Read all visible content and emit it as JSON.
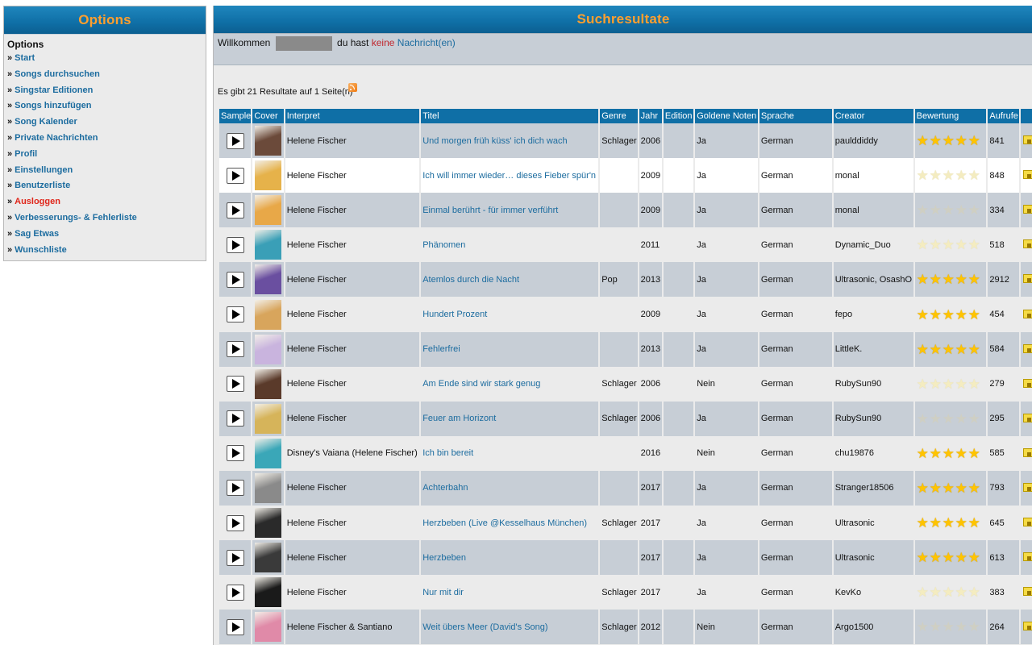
{
  "sidebar": {
    "header": "Options",
    "title": "Options",
    "items": [
      {
        "label": "Start"
      },
      {
        "label": "Songs durchsuchen"
      },
      {
        "label": "Singstar Editionen"
      },
      {
        "label": "Songs hinzufügen"
      },
      {
        "label": "Song Kalender"
      },
      {
        "label": "Private Nachrichten"
      },
      {
        "label": "Profil"
      },
      {
        "label": "Einstellungen"
      },
      {
        "label": "Benutzerliste"
      },
      {
        "label": "Ausloggen",
        "style": "logout"
      },
      {
        "label": "Verbesserungs- & Fehlerliste"
      },
      {
        "label": "Sag Etwas"
      },
      {
        "label": "Wunschliste"
      }
    ],
    "bullet": "»"
  },
  "main": {
    "header": "Suchresultate",
    "welcome": {
      "prefix": "Willkommen",
      "middle": "du hast",
      "keine": "keine",
      "nachrichten": "Nachricht(en)"
    },
    "results_line": "Es gibt 21 Resultate auf 1 Seite(n)",
    "columns": [
      "Sample",
      "Cover",
      "Interpret",
      "Titel",
      "Genre",
      "Jahr",
      "Edition",
      "Goldene Noten",
      "Sprache",
      "Creator",
      "Bewertung",
      "Aufrufe",
      ""
    ],
    "rows": [
      {
        "interpret": "Helene Fischer",
        "titel": "Und morgen früh küss' ich dich wach",
        "genre": "Schlager",
        "jahr": "2006",
        "edition": "",
        "goldene": "Ja",
        "sprache": "German",
        "creator": "paulddiddy",
        "rating": 4.5,
        "aufrufe": "841",
        "cover_color": "#6b4a3a"
      },
      {
        "interpret": "Helene Fischer",
        "titel": "Ich will immer wieder… dieses Fieber spür'n",
        "genre": "",
        "jahr": "2009",
        "edition": "",
        "goldene": "Ja",
        "sprache": "German",
        "creator": "monal",
        "rating": 0,
        "aufrufe": "848",
        "cover_color": "#e6b24a"
      },
      {
        "interpret": "Helene Fischer",
        "titel": "Einmal berührt - für immer verführt",
        "genre": "",
        "jahr": "2009",
        "edition": "",
        "goldene": "Ja",
        "sprache": "German",
        "creator": "monal",
        "rating": 0,
        "aufrufe": "334",
        "cover_color": "#e8a848"
      },
      {
        "interpret": "Helene Fischer",
        "titel": "Phänomen",
        "genre": "",
        "jahr": "2011",
        "edition": "",
        "goldene": "Ja",
        "sprache": "German",
        "creator": "Dynamic_Duo",
        "rating": 0,
        "aufrufe": "518",
        "cover_color": "#3a9fb7"
      },
      {
        "interpret": "Helene Fischer",
        "titel": "Atemlos durch die Nacht",
        "genre": "Pop",
        "jahr": "2013",
        "edition": "",
        "goldene": "Ja",
        "sprache": "German",
        "creator": "Ultrasonic, OsashO",
        "rating": 5,
        "aufrufe": "2912",
        "cover_color": "#6a4fa0"
      },
      {
        "interpret": "Helene Fischer",
        "titel": "Hundert Prozent",
        "genre": "",
        "jahr": "2009",
        "edition": "",
        "goldene": "Ja",
        "sprache": "German",
        "creator": "fepo",
        "rating": 5,
        "aufrufe": "454",
        "cover_color": "#d8a55c"
      },
      {
        "interpret": "Helene Fischer",
        "titel": "Fehlerfrei",
        "genre": "",
        "jahr": "2013",
        "edition": "",
        "goldene": "Ja",
        "sprache": "German",
        "creator": "LittleK.",
        "rating": 5,
        "aufrufe": "584",
        "cover_color": "#c9b4de"
      },
      {
        "interpret": "Helene Fischer",
        "titel": "Am Ende sind wir stark genug",
        "genre": "Schlager",
        "jahr": "2006",
        "edition": "",
        "goldene": "Nein",
        "sprache": "German",
        "creator": "RubySun90",
        "rating": 0,
        "aufrufe": "279",
        "cover_color": "#5a3a2a"
      },
      {
        "interpret": "Helene Fischer",
        "titel": "Feuer am Horizont",
        "genre": "Schlager",
        "jahr": "2006",
        "edition": "",
        "goldene": "Ja",
        "sprache": "German",
        "creator": "RubySun90",
        "rating": 0,
        "aufrufe": "295",
        "cover_color": "#d6b45a"
      },
      {
        "interpret": "Disney's Vaiana (Helene Fischer)",
        "titel": "Ich bin bereit",
        "genre": "",
        "jahr": "2016",
        "edition": "",
        "goldene": "Nein",
        "sprache": "German",
        "creator": "chu19876",
        "rating": 5,
        "aufrufe": "585",
        "cover_color": "#3aa7b8"
      },
      {
        "interpret": "Helene Fischer",
        "titel": "Achterbahn",
        "genre": "",
        "jahr": "2017",
        "edition": "",
        "goldene": "Ja",
        "sprache": "German",
        "creator": "Stranger18506",
        "rating": 5,
        "aufrufe": "793",
        "cover_color": "#8a8a8a"
      },
      {
        "interpret": "Helene Fischer",
        "titel": "Herzbeben (Live @Kesselhaus München)",
        "genre": "Schlager",
        "jahr": "2017",
        "edition": "",
        "goldene": "Ja",
        "sprache": "German",
        "creator": "Ultrasonic",
        "rating": 5,
        "aufrufe": "645",
        "cover_color": "#2a2a2a"
      },
      {
        "interpret": "Helene Fischer",
        "titel": "Herzbeben",
        "genre": "",
        "jahr": "2017",
        "edition": "",
        "goldene": "Ja",
        "sprache": "German",
        "creator": "Ultrasonic",
        "rating": 4.5,
        "aufrufe": "613",
        "cover_color": "#3a3a3a"
      },
      {
        "interpret": "Helene Fischer",
        "titel": "Nur mit dir",
        "genre": "Schlager",
        "jahr": "2017",
        "edition": "",
        "goldene": "Ja",
        "sprache": "German",
        "creator": "KevKo",
        "rating": 0,
        "aufrufe": "383",
        "cover_color": "#1a1a1a"
      },
      {
        "interpret": "Helene Fischer & Santiano",
        "titel": "Weit übers Meer (David's Song)",
        "genre": "Schlager",
        "jahr": "2012",
        "edition": "",
        "goldene": "Nein",
        "sprache": "German",
        "creator": "Argo1500",
        "rating": 0,
        "aufrufe": "264",
        "cover_color": "#e08aa8"
      }
    ],
    "icons": {
      "play": "play-icon",
      "rss": "rss-icon",
      "note": "comment-icon",
      "star": "star-icon"
    }
  }
}
